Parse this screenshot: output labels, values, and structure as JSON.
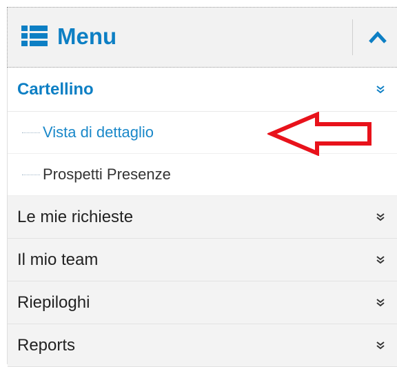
{
  "header": {
    "title": "Menu"
  },
  "sections": {
    "cartellino": {
      "label": "Cartellino",
      "items": [
        {
          "label": "Vista di dettaglio"
        },
        {
          "label": "Prospetti Presenze"
        }
      ]
    },
    "others": [
      {
        "label": "Le mie richieste"
      },
      {
        "label": "Il mio team"
      },
      {
        "label": "Riepiloghi"
      },
      {
        "label": "Reports"
      }
    ]
  },
  "colors": {
    "accent": "#0d7fc4",
    "annotation_arrow": "#e8121b"
  },
  "icons": {
    "menu": "list-icon",
    "collapse": "chevron-up-icon",
    "expand": "double-chevron-down-icon",
    "annotation": "arrow-left-outline"
  }
}
